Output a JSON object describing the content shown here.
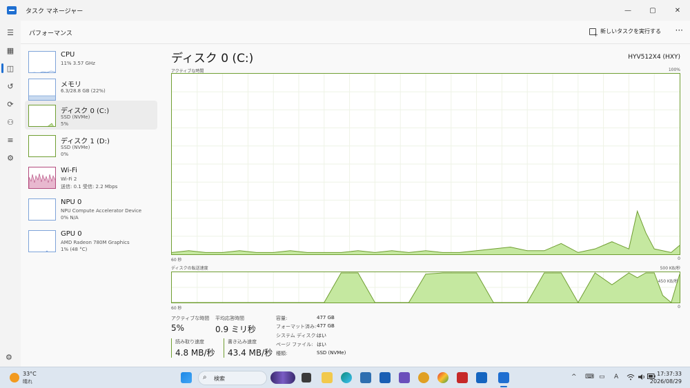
{
  "window": {
    "title": "タスク マネージャー",
    "controls": {
      "minimize": "—",
      "maximize": "▢",
      "close": "✕"
    }
  },
  "header": {
    "title": "パフォーマンス",
    "run_task_label": "新しいタスクを実行する",
    "more_label": "···"
  },
  "sidebar": {
    "items": [
      {
        "name": "CPU",
        "sub1": "11% 3.57 GHz",
        "sub2": "",
        "sub3": ""
      },
      {
        "name": "メモリ",
        "sub1": "6.3/28.8 GB (22%)",
        "sub2": "",
        "sub3": ""
      },
      {
        "name": "ディスク 0 (C:)",
        "sub1": "SSD (NVMe)",
        "sub2": "5%",
        "sub3": ""
      },
      {
        "name": "ディスク 1 (D:)",
        "sub1": "SSD (NVMe)",
        "sub2": "0%",
        "sub3": ""
      },
      {
        "name": "Wi-Fi",
        "sub1": "Wi-Fi 2",
        "sub2": "送信: 0.1 受信: 2.2 Mbps",
        "sub3": ""
      },
      {
        "name": "NPU 0",
        "sub1": "NPU Compute Accelerator Device",
        "sub2": "0% N/A",
        "sub3": ""
      },
      {
        "name": "GPU 0",
        "sub1": "AMD Radeon 780M Graphics",
        "sub2": "1% (48 °C)",
        "sub3": ""
      }
    ]
  },
  "disk": {
    "title": "ディスク 0 (C:)",
    "model": "HYV512X4 (HXY)",
    "active_time_graph": {
      "label": "アクティブな時間",
      "max_label": "100%",
      "left_label": "60 秒",
      "right_label": "0"
    },
    "transfer_graph": {
      "label": "ディスクの転送速度",
      "max_label": "500 KB/秒",
      "mid_label": "450 KB/秒",
      "left_label": "60 秒",
      "right_label": "0"
    },
    "stats": {
      "active_time_label": "アクティブな時間",
      "active_time_value": "5%",
      "avg_response_label": "平均応答時間",
      "avg_response_value": "0.9 ミリ秒",
      "read_label": "読み取り速度",
      "read_value": "4.8 MB/秒",
      "write_label": "書き込み速度",
      "write_value": "43.4 MB/秒"
    },
    "properties": [
      {
        "key": "容量:",
        "value": "477 GB"
      },
      {
        "key": "フォーマット済み:",
        "value": "477 GB"
      },
      {
        "key": "システム ディスク:",
        "value": "はい"
      },
      {
        "key": "ページ ファイル:",
        "value": "はい"
      },
      {
        "key": "種類:",
        "value": "SSD (NVMe)"
      }
    ]
  },
  "chart_data": [
    {
      "type": "area",
      "title": "アクティブな時間",
      "ylim": [
        0,
        100
      ],
      "x": [
        60,
        58,
        56,
        54,
        52,
        50,
        48,
        46,
        44,
        42,
        40,
        38,
        36,
        34,
        32,
        30,
        28,
        26,
        24,
        22,
        20,
        18,
        16,
        14,
        12,
        10,
        8,
        6,
        5,
        4,
        3,
        2,
        1,
        0
      ],
      "values": [
        1,
        2,
        1,
        1,
        2,
        1,
        1,
        2,
        1,
        1,
        1,
        2,
        1,
        2,
        1,
        2,
        1,
        1,
        2,
        3,
        4,
        2,
        2,
        6,
        1,
        3,
        7,
        3,
        24,
        12,
        3,
        2,
        1,
        5
      ]
    },
    {
      "type": "area",
      "title": "ディスクの転送速度",
      "ylim": [
        0,
        500
      ],
      "x": [
        60,
        58,
        56,
        54,
        52,
        50,
        48,
        46,
        44,
        42,
        40,
        38,
        36,
        34,
        32,
        30,
        28,
        26,
        24,
        22,
        20,
        18,
        16,
        14,
        12,
        10,
        8,
        6,
        5,
        4,
        3,
        2,
        1,
        0
      ],
      "values": [
        0,
        0,
        0,
        0,
        0,
        0,
        0,
        0,
        0,
        0,
        500,
        500,
        0,
        0,
        0,
        480,
        500,
        500,
        500,
        0,
        0,
        0,
        500,
        500,
        0,
        500,
        300,
        500,
        420,
        500,
        500,
        120,
        0,
        480
      ]
    }
  ],
  "taskbar": {
    "weather_temp": "33°C",
    "weather_cond": "晴れ",
    "search_label": "検索",
    "clock_time": "17:37:33",
    "clock_date": "2026/08/29",
    "tray": [
      "^",
      "⌨",
      "▭",
      "A",
      "wifi",
      "volume",
      "battery"
    ]
  }
}
